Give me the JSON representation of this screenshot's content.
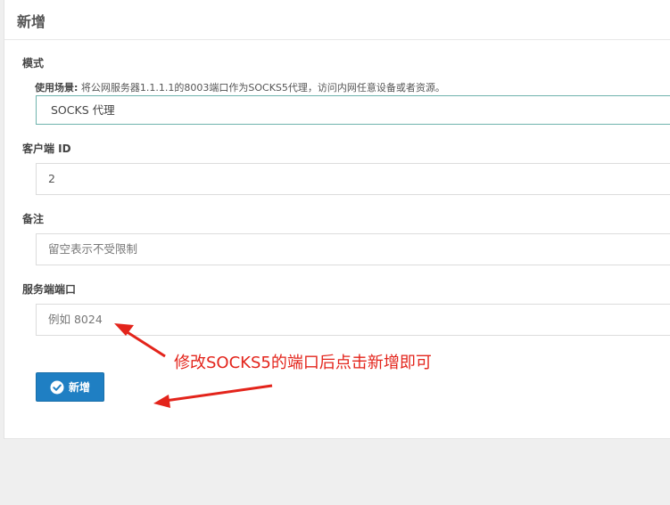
{
  "panel": {
    "title": "新增"
  },
  "form": {
    "mode": {
      "label": "模式",
      "hint_label": "使用场景:",
      "hint_text": " 将公网服务器1.1.1.1的8003端口作为SOCKS5代理，访问内网任意设备或者资源。",
      "value": "SOCKS 代理"
    },
    "client_id": {
      "label": "客户端 ID",
      "value": "2"
    },
    "remark": {
      "label": "备注",
      "placeholder": "留空表示不受限制"
    },
    "server_port": {
      "label": "服务端端口",
      "placeholder": "例如 8024"
    },
    "submit_label": "新增"
  },
  "annotation": {
    "text": "修改SOCKS5的端口后点击新增即可",
    "color": "#e3241b"
  },
  "icons": {
    "submit": "check-circle-icon"
  },
  "colors": {
    "primary_button": "#1f7fc3",
    "select_border": "#6fb3ad",
    "annotation": "#e3241b"
  }
}
